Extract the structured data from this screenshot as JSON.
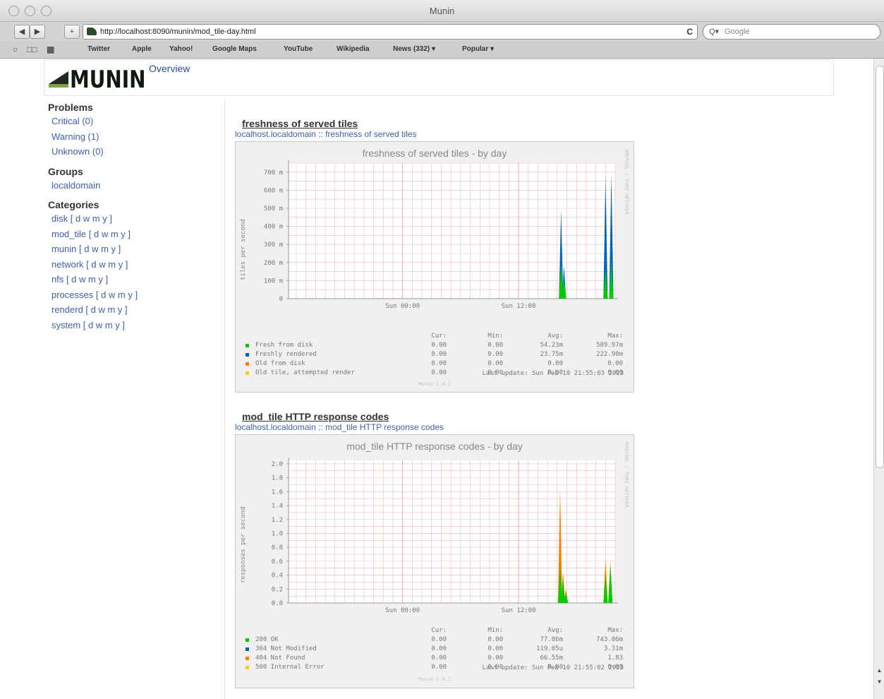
{
  "window": {
    "title": "Munin"
  },
  "browser": {
    "url": "http://localhost:8090/munin/mod_tile-day.html",
    "reload_icon": "C",
    "search_placeholder": "Google",
    "search_icon": "Q▾",
    "back_label": "◀",
    "forward_label": "▶",
    "add_label": "+",
    "bookmarks": [
      "Twitter",
      "Apple",
      "Yahoo!",
      "Google Maps",
      "YouTube",
      "Wikipedia",
      "News (332) ▾",
      "Popular ▾"
    ]
  },
  "header": {
    "logo_text": "MUNIN",
    "overview": "Overview"
  },
  "sidebar": {
    "problems_title": "Problems",
    "problems": [
      "Critical (0)",
      "Warning (1)",
      "Unknown (0)"
    ],
    "groups_title": "Groups",
    "groups": [
      "localdomain"
    ],
    "categories_title": "Categories",
    "categories": [
      "disk [ d w m y ]",
      "mod_tile [ d w m y ]",
      "munin [ d w m y ]",
      "network [ d w m y ]",
      "nfs [ d w m y ]",
      "processes [ d w m y ]",
      "renderd [ d w m y ]",
      "system [ d w m y ]"
    ]
  },
  "colors": {
    "green": "#00cc00",
    "blue": "#0066b3",
    "orange": "#ff8000",
    "yellow": "#ffcc00",
    "grid": "#f2b9b9",
    "link": "#3f5fa8"
  },
  "chart_data": [
    {
      "type": "area",
      "heading": "freshness of served tiles",
      "crumb": "localhost.localdomain :: freshness of served tiles",
      "title": "freshness of served tiles - by day",
      "ylabel": "tiles per second",
      "side_label": "RRDTOOL / TOBI OETIKER",
      "ylim": [
        0,
        750
      ],
      "yticks": [
        "0",
        "100 m",
        "200 m",
        "300 m",
        "400 m",
        "500 m",
        "600 m",
        "700 m"
      ],
      "ytick_values": [
        0,
        0.1,
        0.2,
        0.3,
        0.4,
        0.5,
        0.6,
        0.7
      ],
      "xticks": [
        "Sun 00:00",
        "Sun 12:00"
      ],
      "x_tick_hours": [
        0,
        12
      ],
      "x_range_hours": [
        -11.8,
        22.0
      ],
      "spikes": [
        {
          "hour": 16.4,
          "values": {
            "Fresh from disk": 0.19,
            "Freshly rendered": 0.49
          }
        },
        {
          "hour": 16.7,
          "values": {
            "Fresh from disk": 0.12,
            "Freshly rendered": 0.18
          }
        },
        {
          "hour": 21.0,
          "values": {
            "Fresh from disk": 0.16,
            "Freshly rendered": 0.68
          }
        },
        {
          "hour": 21.6,
          "values": {
            "Fresh from disk": 0.2,
            "Freshly rendered": 0.69
          }
        }
      ],
      "legend_headers": [
        "Cur:",
        "Min:",
        "Avg:",
        "Max:"
      ],
      "series": [
        {
          "name": "Fresh from disk",
          "color": "#00cc00",
          "cur": "0.00",
          "min": "0.00",
          "avg": "54.23m",
          "max": "589.97m"
        },
        {
          "name": "Freshly rendered",
          "color": "#0066b3",
          "cur": "0.00",
          "min": "0.00",
          "avg": "23.75m",
          "max": "222.90m"
        },
        {
          "name": "Old from disk",
          "color": "#ff8000",
          "cur": "0.00",
          "min": "0.00",
          "avg": "0.00",
          "max": "0.00"
        },
        {
          "name": "Old tile, attempted render",
          "color": "#ffcc00",
          "cur": "0.00",
          "min": "0.00",
          "avg": "0.00",
          "max": "0.00"
        }
      ],
      "last_update": "Last update: Sun Feb 10 21:55:03 2013",
      "version": "Munin 1.4.2"
    },
    {
      "type": "area",
      "heading": "mod_tile HTTP response codes",
      "crumb": "localhost.localdomain :: mod_tile HTTP response codes",
      "title": "mod_tile HTTP response codes - by day",
      "ylabel": "responses per second",
      "side_label": "RRDTOOL / TOBI OETIKER",
      "ylim": [
        0,
        2.05
      ],
      "yticks": [
        "0.0",
        "0.2",
        "0.4",
        "0.6",
        "0.8",
        "1.0",
        "1.2",
        "1.4",
        "1.6",
        "1.8",
        "2.0"
      ],
      "ytick_values": [
        0,
        0.2,
        0.4,
        0.6,
        0.8,
        1.0,
        1.2,
        1.4,
        1.6,
        1.8,
        2.0
      ],
      "xticks": [
        "Sun 00:00",
        "Sun 12:00"
      ],
      "x_tick_hours": [
        0,
        12
      ],
      "x_range_hours": [
        -11.8,
        22.0
      ],
      "spikes": [
        {
          "hour": 16.3,
          "values": {
            "200 OK": 0.55,
            "404 Not Found": 1.65
          }
        },
        {
          "hour": 16.6,
          "values": {
            "200 OK": 0.35,
            "404 Not Found": 0.45
          }
        },
        {
          "hour": 16.9,
          "values": {
            "200 OK": 0.15,
            "404 Not Found": 0.2
          }
        },
        {
          "hour": 21.0,
          "values": {
            "200 OK": 0.4,
            "404 Not Found": 0.65
          }
        },
        {
          "hour": 21.5,
          "values": {
            "200 OK": 0.55,
            "404 Not Found": 0.6
          }
        }
      ],
      "legend_headers": [
        "Cur:",
        "Min:",
        "Avg:",
        "Max:"
      ],
      "series": [
        {
          "name": "200 OK",
          "color": "#00cc00",
          "cur": "0.00",
          "min": "0.00",
          "avg": "77.86m",
          "max": "743.06m"
        },
        {
          "name": "304 Not Modified",
          "color": "#0066b3",
          "cur": "0.00",
          "min": "0.00",
          "avg": "119.05u",
          "max": "3.31m"
        },
        {
          "name": "404 Not Found",
          "color": "#ff8000",
          "cur": "0.00",
          "min": "0.00",
          "avg": "66.55m",
          "max": "1.83"
        },
        {
          "name": "500 Internal Error",
          "color": "#ffcc00",
          "cur": "0.00",
          "min": "0.00",
          "avg": "0.00",
          "max": "0.00"
        }
      ],
      "last_update": "Last update: Sun Feb 10 21:55:02 2013",
      "version": "Munin 1.4.2"
    }
  ]
}
